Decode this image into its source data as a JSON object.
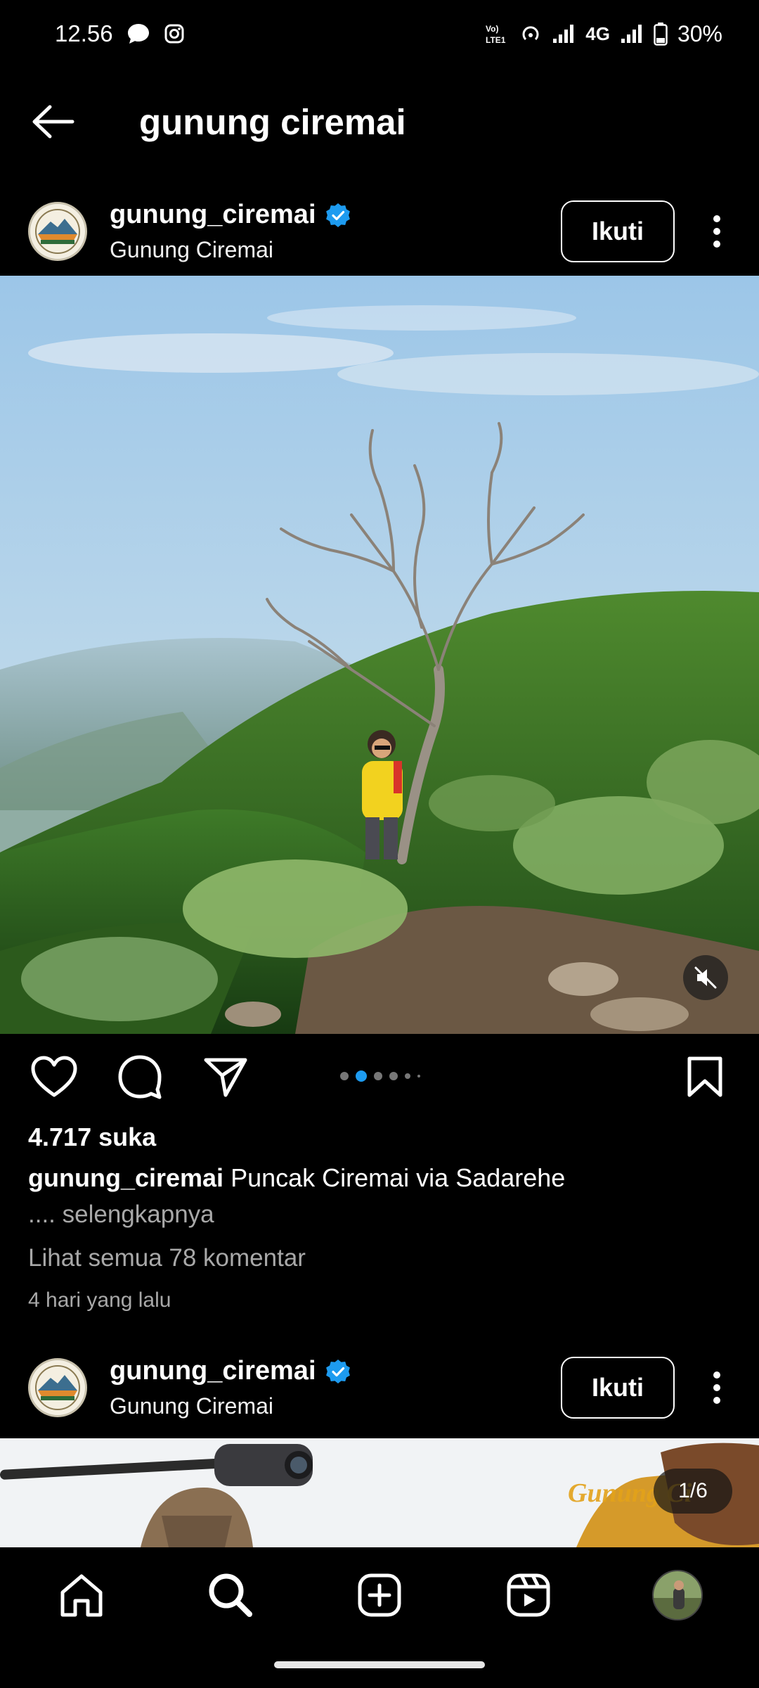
{
  "status_bar": {
    "time": "12.56",
    "network": "4G",
    "battery": "30%"
  },
  "header": {
    "title": "gunung ciremai"
  },
  "post1": {
    "username": "gunung_ciremai",
    "location": "Gunung Ciremai",
    "follow_label": "Ikuti",
    "likes": "4.717 suka",
    "caption_user": "gunung_ciremai",
    "caption_text": "Puncak Ciremai via Sadarehe",
    "more_label": ".... selengkapnya",
    "comments_label": "Lihat semua 78 komentar",
    "time_ago": "4 hari yang lalu",
    "carousel_index": 2,
    "carousel_dots_visible": 6
  },
  "post2": {
    "username": "gunung_ciremai",
    "location": "Gunung Ciremai",
    "follow_label": "Ikuti",
    "counter": "1/6"
  },
  "colors": {
    "background": "#000000",
    "verified": "#1d9bf0",
    "active_dot": "#1d9bf0",
    "secondary_text": "#a8a8a8"
  },
  "icons": {
    "back": "arrow-left-icon",
    "verified": "verified-badge-icon",
    "more": "more-vertical-icon",
    "like": "heart-icon",
    "comment": "comment-icon",
    "share": "send-icon",
    "save": "bookmark-icon",
    "mute": "speaker-muted-icon",
    "nav": [
      "home-icon",
      "search-icon",
      "create-icon",
      "reels-icon",
      "profile-avatar"
    ]
  }
}
